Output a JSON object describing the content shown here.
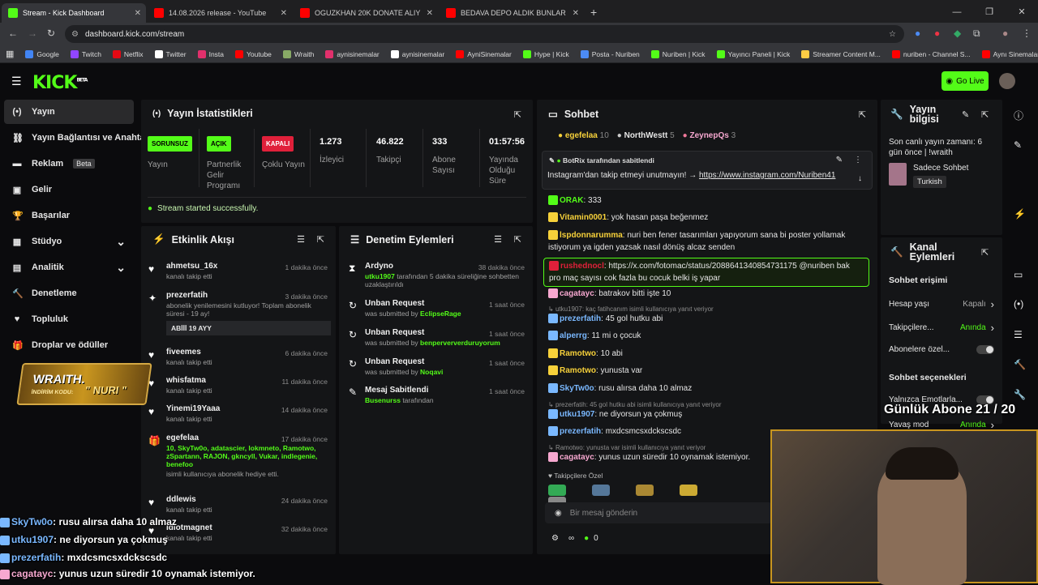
{
  "browser": {
    "tabs": [
      {
        "title": "Stream - Kick Dashboard",
        "active": true,
        "color": "#53fc18"
      },
      {
        "title": "14.08.2026 release - YouTube",
        "active": false,
        "color": "#ff0000"
      },
      {
        "title": "OGUZKHAN 20K DONATE ALIY",
        "active": false,
        "color": "#ff0000"
      },
      {
        "title": "BEDAVA DEPO ALDIK BUNLAR ",
        "active": false,
        "color": "#ff0000"
      }
    ],
    "url": "dashboard.kick.com/stream",
    "bookmarks": [
      "Google",
      "Twitch",
      "Netflix",
      "Twitter",
      "Insta",
      "Youtube",
      "Wraith",
      "aynisinemalar",
      "aynisinemalar",
      "AyniSinemalar",
      "Hype | Kick",
      "Posta - Nuriben",
      "Nuriben | Kick",
      "Yayıncı Paneli | Kick",
      "Streamer Content M...",
      "nuriben - Channel S...",
      "Aynı Sinemalar - Ça..."
    ]
  },
  "header": {
    "go_live": "Go Live"
  },
  "sidebar": {
    "items": [
      {
        "label": "Yayın",
        "icon": "broadcast-icon"
      },
      {
        "label": "Yayın Bağlantısı ve Anahtarı",
        "icon": "link-icon"
      },
      {
        "label": "Reklam",
        "icon": "ad-icon",
        "badge": "Beta"
      },
      {
        "label": "Gelir",
        "icon": "wallet-icon"
      },
      {
        "label": "Başarılar",
        "icon": "trophy-icon"
      },
      {
        "label": "Stüdyo",
        "icon": "studio-icon"
      },
      {
        "label": "Analitik",
        "icon": "chart-icon"
      },
      {
        "label": "Denetleme",
        "icon": "hammer-icon"
      },
      {
        "label": "Topluluk",
        "icon": "heart-icon"
      },
      {
        "label": "Droplar ve ödüller",
        "icon": "gift-icon"
      }
    ]
  },
  "stats": {
    "title": "Yayın İstatistikleri",
    "status_badges": [
      {
        "badge": "SORUNSUZ",
        "label": "Yayın",
        "color": "#53fc18"
      },
      {
        "badge": "AÇIK",
        "label": "Partnerlik Gelir Programı",
        "color": "#53fc18"
      },
      {
        "badge": "KAPALI",
        "label": "Çoklu Yayın",
        "color": "#e0203a"
      }
    ],
    "metrics": [
      {
        "value": "1.273",
        "label": "İzleyici"
      },
      {
        "value": "46.822",
        "label": "Takipçi"
      },
      {
        "value": "333",
        "label": "Abone Sayısı"
      },
      {
        "value": "01:57:56",
        "label": "Yayında Olduğu Süre"
      }
    ],
    "success_msg": "Stream started successfully."
  },
  "activity": {
    "title": "Etkinlik Akışı",
    "items": [
      {
        "name": "ahmetsu_16x",
        "sub": "kanalı takip etti",
        "time": "1 dakika önce"
      },
      {
        "name": "prezerfatih",
        "sub": "abonelik yenilemesini kutluyor! Toplam abonelik süresi - 19 ay!",
        "time": "3 dakika önce",
        "extra": "ABİİİ 19 AYY"
      },
      {
        "name": "fiveemes",
        "sub": "kanalı takip etti",
        "time": "6 dakika önce"
      },
      {
        "name": "whisfatma",
        "sub": "kanalı takip etti",
        "time": "11 dakika önce"
      },
      {
        "name": "Yinemi19Yaaa",
        "sub": "kanalı takip etti",
        "time": "14 dakika önce"
      },
      {
        "name": "egefelaa",
        "sub": "10, SkyTw0o, adatascier, lokmneto, Ramotwo, zSpartann, RAJON, gkncyll, Vukar, indlegenie, benefoo",
        "sub2": "isimli kullanıcıya abonelik hediye etti.",
        "time": "17 dakika önce"
      },
      {
        "name": "ddlewis",
        "sub": "kanalı takip etti",
        "time": "24 dakika önce"
      },
      {
        "name": "idiotmagnet",
        "sub": "kanalı takip etti",
        "time": "32 dakika önce"
      }
    ]
  },
  "moderation": {
    "title": "Denetim Eylemleri",
    "items": [
      {
        "name": "Ardyno",
        "sub_user": "utku1907",
        "sub": "tarafından 5 dakika süreliğine sohbetten uzaklaştırıldı",
        "time": "38 dakika önce"
      },
      {
        "name": "Unban Request",
        "sub": "was submitted by",
        "sub_user": "EclipseRage",
        "time": "1 saat önce"
      },
      {
        "name": "Unban Request",
        "sub": "was submitted by",
        "sub_user": "benperververduruyorum",
        "time": "1 saat önce"
      },
      {
        "name": "Unban Request",
        "sub": "was submitted by",
        "sub_user": "Noqavi",
        "time": "1 saat önce"
      },
      {
        "name": "Mesaj Sabitlendi",
        "sub_user": "Busenurss",
        "sub": "tarafından",
        "time": "1 saat önce"
      }
    ]
  },
  "chat": {
    "title": "Sohbet",
    "top_gifters": [
      {
        "name": "egefelaa",
        "count": "10"
      },
      {
        "name": "NorthWestt",
        "count": "5"
      },
      {
        "name": "ZeynepQs",
        "count": "3"
      }
    ],
    "pinned_by": "BotRix tarafından sabitlendi",
    "pinned_text": "Instagram'dan takip etmeyi unutmayın! → ",
    "pinned_link": "https://www.instagram.com/Nuriben41",
    "messages": [
      {
        "user": "ORAK",
        "text": "333",
        "color": "#53fc18"
      },
      {
        "user": "Vitamin0001",
        "text": "yok hasan paşa beğenmez",
        "color": "#f7d13a"
      },
      {
        "user": "lspdonnarumma",
        "text": "nuri ben fener tasarımları yapıyorum sana bi poster yollamak istiyorum ya igden yazsak nasıl dönüş alcaz senden",
        "color": "#f7d13a"
      },
      {
        "user": "rushednocl",
        "text": "https://x.com/fotomac/status/2088641340854731175 @nuriben bak pro maç sayısı cok fazla bu cocuk belki iş yapar",
        "color": "#e0203a"
      },
      {
        "user": "cagatayc",
        "text": "batrakov bitti işte 10",
        "color": "#f7a8d0"
      },
      {
        "sys": "utku1907: kaç fatihcanım isimli kullanıcıya yanıt veriyor"
      },
      {
        "user": "prezerfatih",
        "text": "45 gol hutku abi",
        "color": "#7ab8ff"
      },
      {
        "user": "alperrg",
        "text": "11 mi o çocuk",
        "color": "#7ab8ff"
      },
      {
        "user": "Ramotwo",
        "text": "10 abi",
        "color": "#f7d13a"
      },
      {
        "user": "Ramotwo",
        "text": "yunusta var",
        "color": "#f7d13a"
      },
      {
        "user": "SkyTw0o",
        "text": "rusu alırsa daha 10 almaz",
        "color": "#7ab8ff"
      },
      {
        "sys": "prezerfatih: 45 gol hutku abi isimli kullanıcıya yanıt veriyor"
      },
      {
        "user": "utku1907",
        "text": "ne diyorsun ya çokmuş",
        "color": "#7ab8ff"
      },
      {
        "user": "prezerfatih",
        "text": "mxdcsmcsxdckscsdc",
        "color": "#7ab8ff"
      },
      {
        "sys": "Ramotwo: yunusta var isimli kullanıcıya yanıt veriyor"
      },
      {
        "user": "cagatayc",
        "text": "yunus uzun süredir 10 oynamak istemiyor.",
        "color": "#f7a8d0"
      }
    ],
    "followers_only": "Takipçilere Özel",
    "input_placeholder": "Bir mesaj gönderin",
    "points": "0"
  },
  "stream_info": {
    "title": "Yayın bilgisi",
    "last_live": "Son canlı yayın zamanı: 6 gün önce | !wraith",
    "category": "Sadece Sohbet",
    "language": "Turkish"
  },
  "channel_actions": {
    "title": "Kanal Eylemleri",
    "chat_access": "Sohbet erişimi",
    "rows": [
      {
        "label": "Hesap yaşı",
        "value": "Kapalı"
      },
      {
        "label": "Takipçilere...",
        "value": "Anında"
      },
      {
        "label": "Abonelere özel...",
        "value": ""
      }
    ],
    "chat_options": "Sohbet seçenekleri",
    "rows2": [
      {
        "label": "Yalnızca Emotlarla...",
        "value": ""
      },
      {
        "label": "Yavaş mod",
        "value": "Anında"
      }
    ]
  },
  "overlay": {
    "daily_subs": "Günlük Abone 21 / 20",
    "wraith_line1": "WRAITH.",
    "wraith_line2": "İNDİRİM KODU:",
    "wraith_code": "\" NURI \"",
    "chat_lines": [
      {
        "user": "SkyTw0o",
        "text": ": rusu alırsa daha 10 almaz",
        "color": "#7ab8ff"
      },
      {
        "user": "utku1907",
        "text": ": ne diyorsun ya çokmuş",
        "color": "#7ab8ff"
      },
      {
        "user": "prezerfatih",
        "text": ": mxdcsmcsxdckscsdc",
        "color": "#7ab8ff"
      },
      {
        "user": "cagatayc",
        "text": ": yunus uzun süredir 10 oynamak istemiyor.",
        "color": "#f7a8d0"
      }
    ]
  }
}
